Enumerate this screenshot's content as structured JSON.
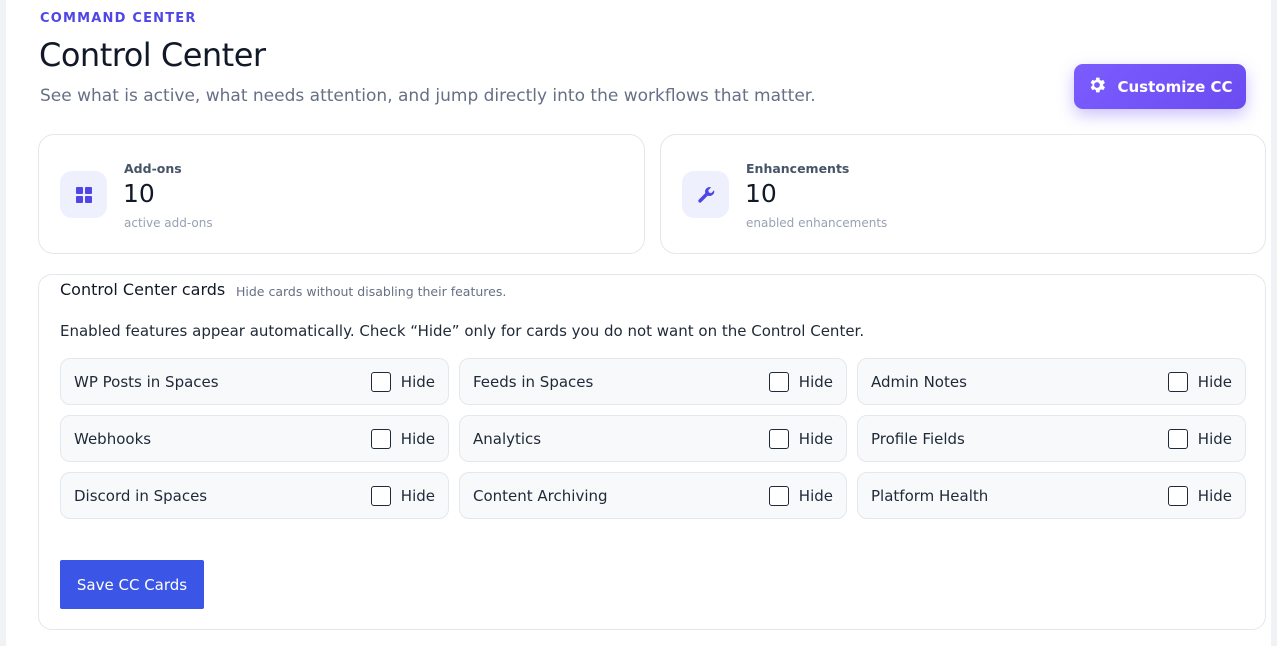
{
  "header": {
    "eyebrow": "COMMAND CENTER",
    "title": "Control Center",
    "subtitle": "See what is active, what needs attention, and jump directly into the workflows that matter.",
    "customize_label": "Customize CC",
    "customize_icon": "gear-icon"
  },
  "stats": [
    {
      "label": "Add-ons",
      "value": "10",
      "sub": "active add-ons",
      "icon": "grid-icon"
    },
    {
      "label": "Enhancements",
      "value": "10",
      "sub": "enabled enhancements",
      "icon": "wrench-icon"
    }
  ],
  "cards_panel": {
    "title": "Control Center cards",
    "hint": "Hide cards without disabling their features.",
    "description": "Enabled features appear automatically. Check “Hide” only for cards you do not want on the Control Center.",
    "hide_label": "Hide",
    "cards": [
      {
        "name": "WP Posts in Spaces",
        "hidden": false
      },
      {
        "name": "Feeds in Spaces",
        "hidden": false
      },
      {
        "name": "Admin Notes",
        "hidden": false
      },
      {
        "name": "Webhooks",
        "hidden": false
      },
      {
        "name": "Analytics",
        "hidden": false
      },
      {
        "name": "Profile Fields",
        "hidden": false
      },
      {
        "name": "Discord in Spaces",
        "hidden": false
      },
      {
        "name": "Content Archiving",
        "hidden": false
      },
      {
        "name": "Platform Health",
        "hidden": false
      }
    ],
    "save_label": "Save CC Cards"
  },
  "colors": {
    "accent": "#4f46e5",
    "button_gradient_start": "#7c5cff",
    "save_button": "#3b55e6"
  }
}
